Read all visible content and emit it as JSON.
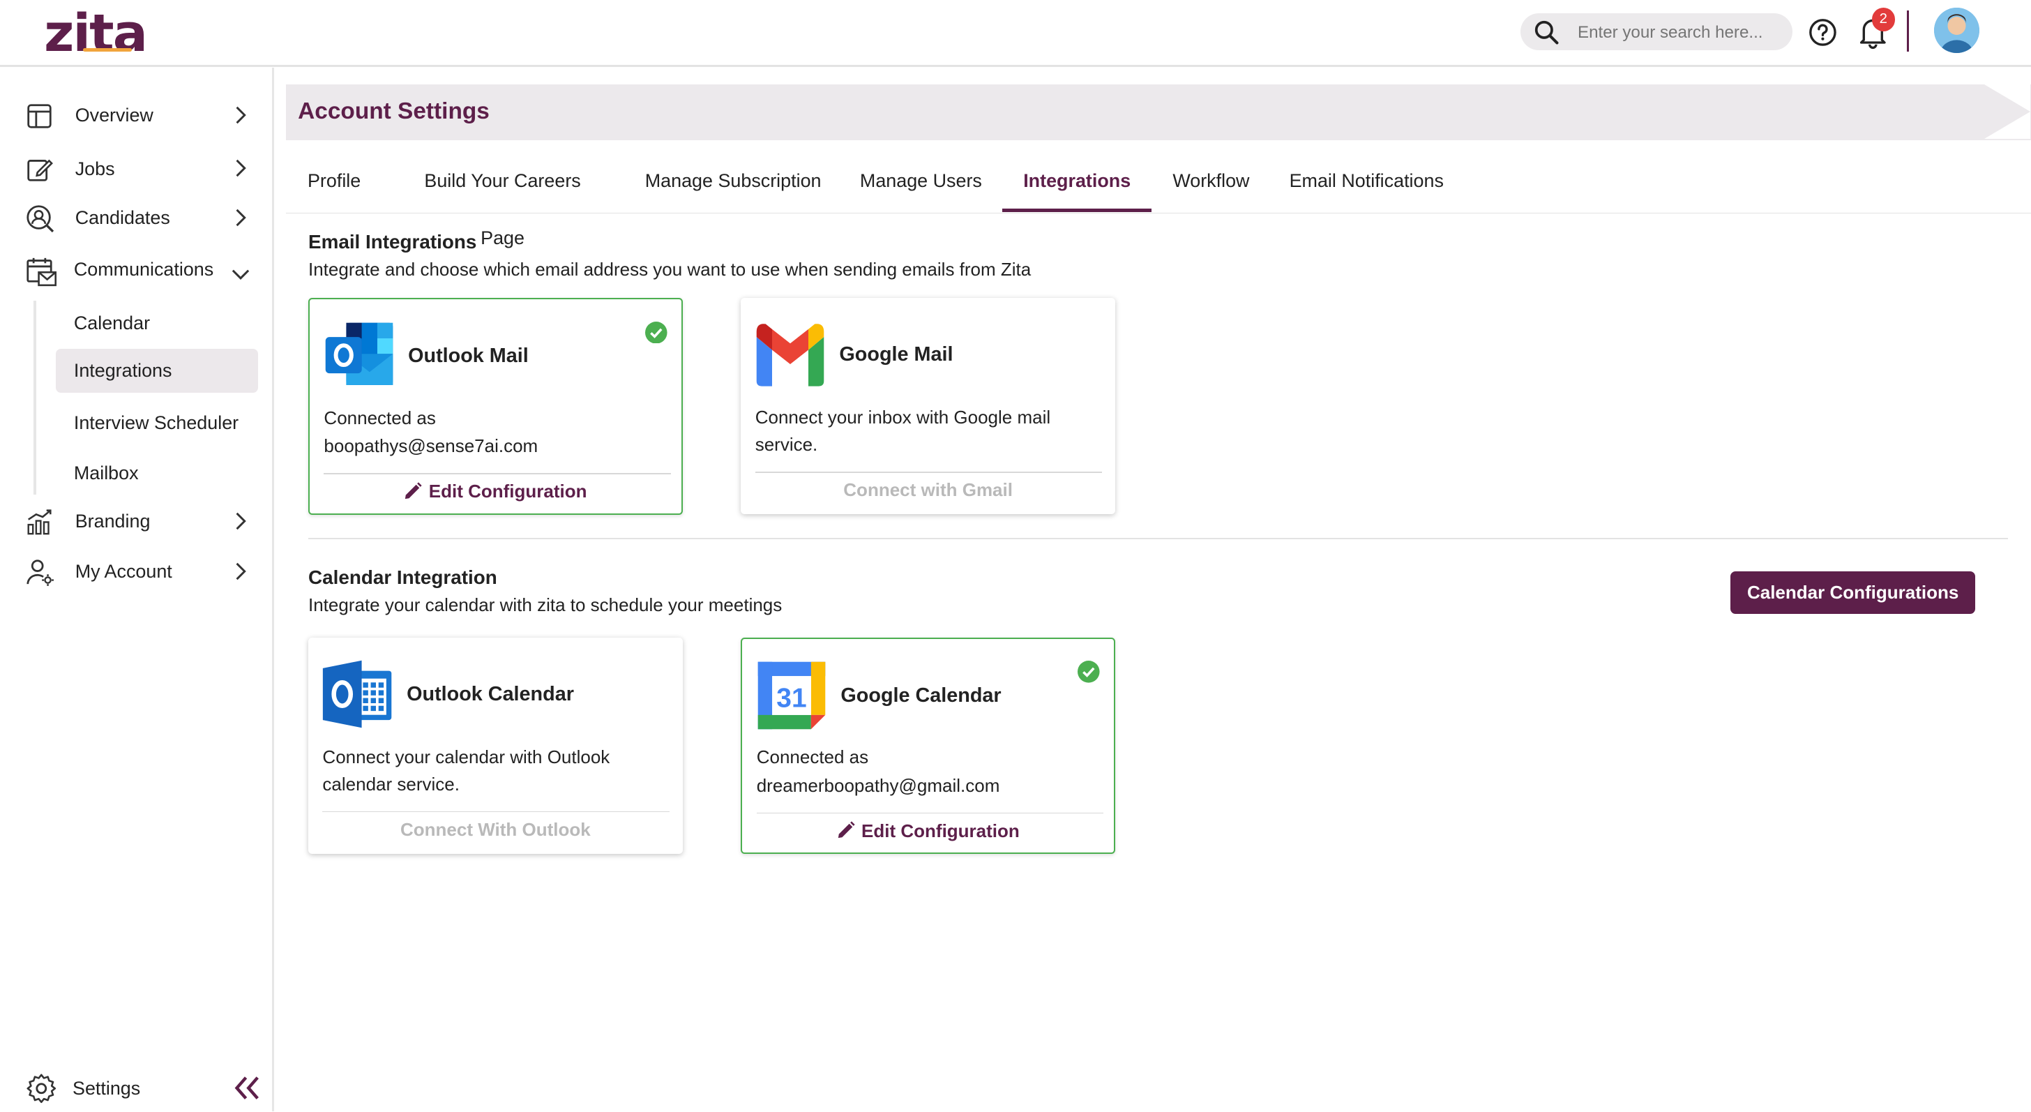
{
  "brand": {
    "logo_text": "zita",
    "accent": "#5d1f4a",
    "highlight": "#f1a43c"
  },
  "header": {
    "search_placeholder": "Enter your search here...",
    "notification_count": "2",
    "icons": [
      "search-icon",
      "help-icon",
      "bell-icon",
      "avatar"
    ]
  },
  "sidebar": {
    "items": [
      {
        "label": "Overview",
        "icon": "overview-icon"
      },
      {
        "label": "Jobs",
        "icon": "jobs-icon"
      },
      {
        "label": "Candidates",
        "icon": "candidates-icon"
      },
      {
        "label": "Communications",
        "icon": "communications-icon",
        "expanded": true
      },
      {
        "label": "Branding",
        "icon": "branding-icon"
      },
      {
        "label": "My Account",
        "icon": "my-account-icon"
      }
    ],
    "sub_items": [
      {
        "label": "Calendar"
      },
      {
        "label": "Integrations",
        "active": true
      },
      {
        "label": "Interview Scheduler"
      },
      {
        "label": "Mailbox"
      }
    ],
    "settings_label": "Settings"
  },
  "main": {
    "title": "Account Settings",
    "tabs": [
      {
        "label": "Profile"
      },
      {
        "label": "Build Your Careers Page"
      },
      {
        "label": "Manage Subscription"
      },
      {
        "label": "Manage Users"
      },
      {
        "label": "Integrations",
        "active": true
      },
      {
        "label": "Workflow"
      },
      {
        "label": "Email Notifications"
      }
    ],
    "email_section": {
      "title": "Email Integrations",
      "subtitle": "Integrate and choose which email address you want to use when sending emails from Zita",
      "cards": [
        {
          "name": "Outlook Mail",
          "connected": true,
          "desc_line1": "Connected as",
          "desc_line2": "boopathys@sense7ai.com",
          "action": "Edit Configuration"
        },
        {
          "name": "Google Mail",
          "connected": false,
          "desc_line1": "Connect your inbox with Google mail",
          "desc_line2": "service.",
          "action": "Connect with Gmail"
        }
      ]
    },
    "calendar_section": {
      "title": "Calendar Integration",
      "subtitle": "Integrate your calendar with zita to schedule your meetings",
      "config_button": "Calendar Configurations",
      "cards": [
        {
          "name": "Outlook Calendar",
          "connected": false,
          "desc_line1": "Connect your calendar with Outlook",
          "desc_line2": "calendar service.",
          "action": "Connect With Outlook"
        },
        {
          "name": "Google Calendar",
          "connected": true,
          "desc_line1": "Connected as",
          "desc_line2": "dreamerboopathy@gmail.com",
          "action": "Edit Configuration",
          "logo_number": "31"
        }
      ]
    }
  },
  "colors": {
    "connected": "#4caf50",
    "disabled_text": "#b9b9b9",
    "active_bg": "#ece8eb"
  }
}
